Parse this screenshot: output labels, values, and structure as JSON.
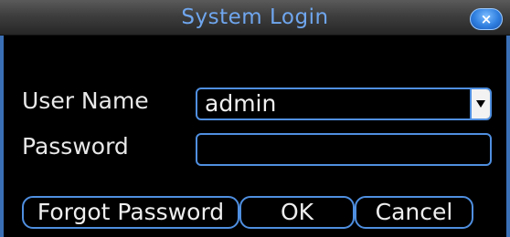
{
  "dialog": {
    "title": "System Login",
    "close_label": "×"
  },
  "form": {
    "username_label": "User Name",
    "username_value": "admin",
    "password_label": "Password",
    "password_value": ""
  },
  "buttons": {
    "forgot_label": "Forgot Password",
    "ok_label": "OK",
    "cancel_label": "Cancel"
  },
  "colors": {
    "accent": "#4f8fe0",
    "title_text": "#6fa6ee",
    "close_button": "#2f7fe0",
    "background": "#000000"
  },
  "icons": {
    "close": "close-icon",
    "dropdown": "chevron-down-icon"
  }
}
